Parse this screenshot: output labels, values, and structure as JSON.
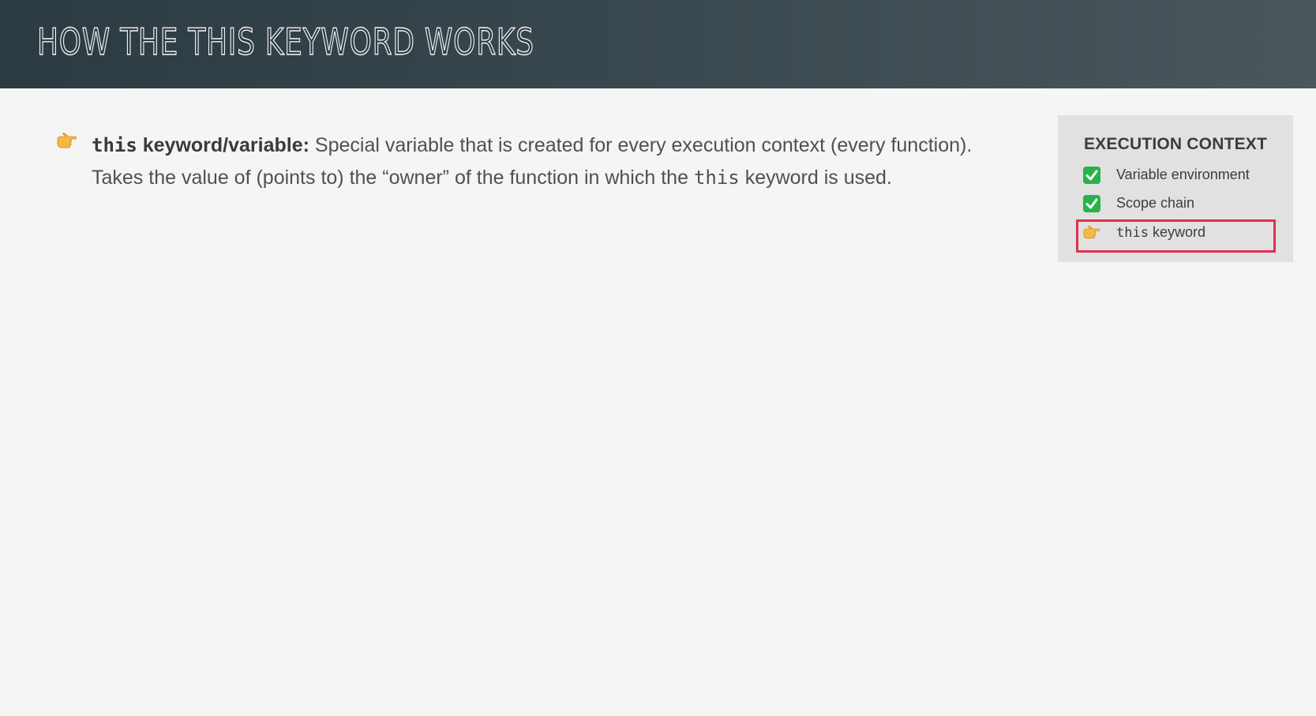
{
  "header": {
    "title": "How the this keyword works"
  },
  "main": {
    "bullet": {
      "icon": "pointing-hand-icon",
      "term": "this",
      "term_suffix": "keyword/variable:",
      "text_part1": "Special variable that is created for every execution context (every function). Takes the value of (points to) the “owner” of the function in which the",
      "code": "this",
      "text_part2": "keyword is used."
    }
  },
  "execution_context": {
    "title": "EXECUTION CONTEXT",
    "items": [
      {
        "icon": "check-icon",
        "label": "Variable environment"
      },
      {
        "icon": "check-icon",
        "label": "Scope chain"
      },
      {
        "icon": "pointing-hand-icon",
        "code": "this",
        "label": "keyword",
        "highlighted": true
      }
    ]
  },
  "colors": {
    "header_bg": "#2c3a42",
    "highlight_border": "#e0314f",
    "check_green": "#2ab24a",
    "hand_yellow": "#f5b942"
  }
}
